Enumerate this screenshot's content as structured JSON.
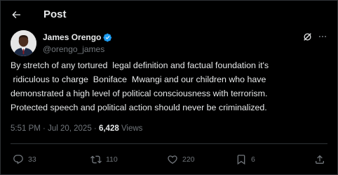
{
  "header": {
    "title": "Post",
    "back_icon": "arrow-left-icon"
  },
  "author": {
    "name": "James Orengo",
    "handle": "@orengo_james",
    "verified": true,
    "verified_color": "#1d9bf0"
  },
  "tweet": {
    "text": "By stretch of any tortured  legal definition and factual foundation it's\n ridiculous to charge  Boniface  Mwangi and our children who have\ndemonstrated a high level of political consciousness with terrorism.\nProtected speech and political action should never be criminalized."
  },
  "meta": {
    "time": "5:51 PM",
    "separator": " · ",
    "date": "Jul 20, 2025",
    "views_count": "6,428",
    "views_label": " Views"
  },
  "actions": {
    "replies": "33",
    "reposts": "110",
    "likes": "220",
    "bookmarks": "6"
  },
  "colors": {
    "background": "#000000",
    "text": "#e7e9ea",
    "muted": "#71767b",
    "border": "#2f3336"
  }
}
